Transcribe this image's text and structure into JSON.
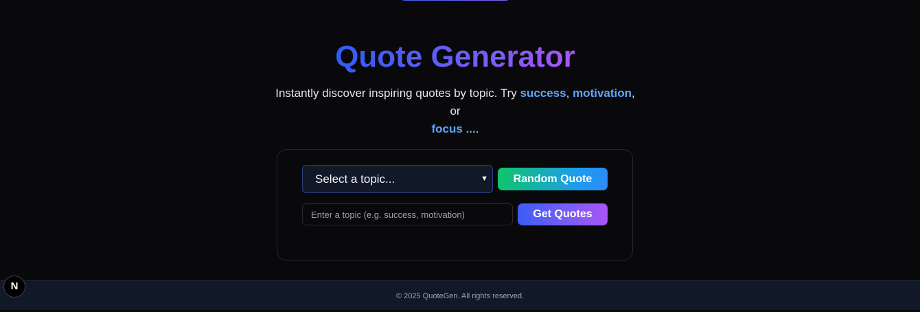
{
  "header": {
    "title": "Quote Generator",
    "subtitle_prefix": "Instantly discover inspiring quotes by topic. Try ",
    "examples": [
      "success",
      "motivation",
      "focus ..."
    ],
    "sep1": ", ",
    "sep2": ", or ",
    "suffix": "."
  },
  "form": {
    "topic_select_value": "Select a topic...",
    "random_button": "Random Quote",
    "topic_input_placeholder": "Enter a topic (e.g. success, motivation)",
    "get_button": "Get Quotes"
  },
  "footer": {
    "text": "© 2025 QuoteGen. All rights reserved."
  },
  "dev_badge": {
    "label": "N",
    "icon": "nextjs-icon"
  },
  "colors": {
    "background": "#09090b",
    "accent_blue": "#60a5fa",
    "title_gradient": [
      "#2f5cf5",
      "#a855f7"
    ],
    "random_gradient": [
      "#10c46a",
      "#2b8cf6"
    ],
    "get_gradient": [
      "#3b5df6",
      "#a855f7"
    ]
  }
}
